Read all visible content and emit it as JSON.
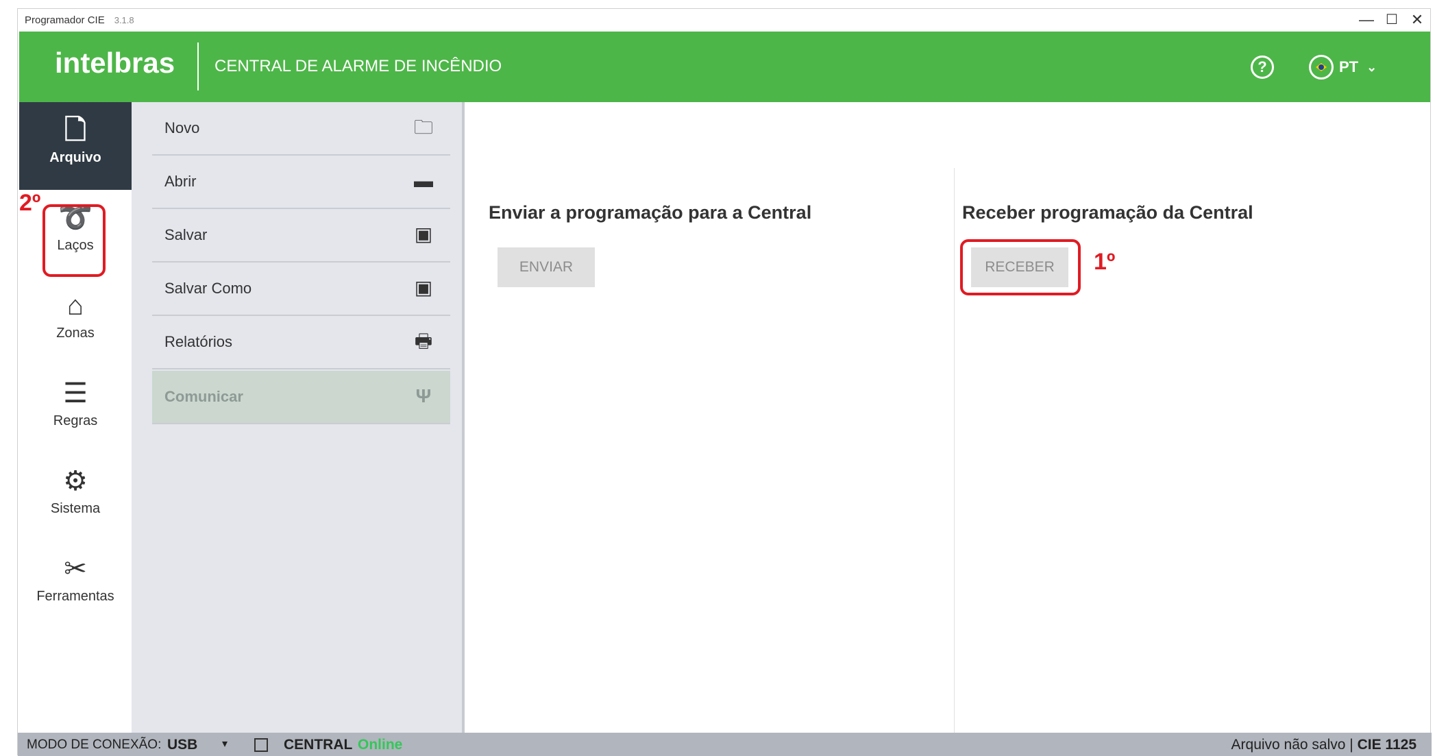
{
  "window": {
    "app_name": "Programador CIE",
    "version": "3.1.8",
    "minimize": "—",
    "maximize": "☐",
    "close": "✕"
  },
  "header": {
    "logo": "intelbras",
    "title": "CENTRAL DE ALARME DE INCÊNDIO",
    "help": "?",
    "language": "PT",
    "lang_chevron": "⌄"
  },
  "leftnav": {
    "items": [
      {
        "label": "Arquivo",
        "icon": "file-icon",
        "glyph": "🗋"
      },
      {
        "label": "Laços",
        "icon": "loop-icon",
        "glyph": "➰"
      },
      {
        "label": "Zonas",
        "icon": "home-icon",
        "glyph": "⌂"
      },
      {
        "label": "Regras",
        "icon": "rules-icon",
        "glyph": "☰"
      },
      {
        "label": "Sistema",
        "icon": "gear-icon",
        "glyph": "⚙"
      },
      {
        "label": "Ferramentas",
        "icon": "tools-icon",
        "glyph": "✂"
      }
    ]
  },
  "submenu": {
    "items": [
      {
        "label": "Novo",
        "icon": "new-folder-icon",
        "glyph": "🗀"
      },
      {
        "label": "Abrir",
        "icon": "folder-icon",
        "glyph": "▬"
      },
      {
        "label": "Salvar",
        "icon": "save-icon",
        "glyph": "▣"
      },
      {
        "label": "Salvar Como",
        "icon": "save-as-icon",
        "glyph": "▣"
      },
      {
        "label": "Relatórios",
        "icon": "print-icon",
        "glyph": "🖶"
      },
      {
        "label": "Comunicar",
        "icon": "usb-icon",
        "glyph": "Ψ"
      }
    ]
  },
  "main": {
    "send_title": "Enviar a programação para a Central",
    "send_button": "ENVIAR",
    "receive_title": "Receber programação da Central",
    "receive_button": "RECEBER"
  },
  "annotations": {
    "first": "1º",
    "second": "2º",
    "color": "#e01b23"
  },
  "statusbar": {
    "mode_label": "MODO DE CONEXÃO:",
    "mode_value": "USB",
    "caret": "▾",
    "central_label": "CENTRAL",
    "central_status": "Online",
    "file_status": "Arquivo não salvo |",
    "model": "CIE 1125"
  },
  "colors": {
    "brand_green": "#4db648",
    "nav_active": "#303a44",
    "submenu_bg": "#e4e6ec",
    "online": "#34c759"
  }
}
